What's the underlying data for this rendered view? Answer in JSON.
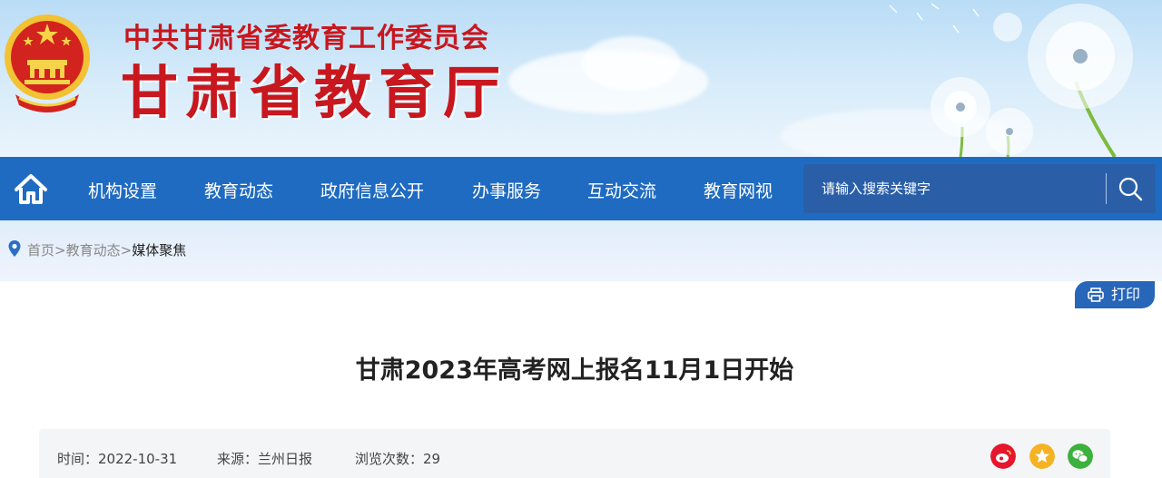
{
  "header": {
    "org_line": "中共甘肃省委教育工作委员会",
    "site_name": "甘肃省教育厅"
  },
  "nav": {
    "home_icon": "home-icon",
    "items": [
      "机构设置",
      "教育动态",
      "政府信息公开",
      "办事服务",
      "互动交流",
      "教育网视"
    ],
    "search_placeholder": "请输入搜索关键字",
    "search_icon": "search-icon"
  },
  "breadcrumb": {
    "icon": "location-pin-icon",
    "home": "首页",
    "sep": ">",
    "section": "教育动态",
    "current": "媒体聚焦"
  },
  "article": {
    "print_label": "打印",
    "print_icon": "printer-icon",
    "title": "甘肃2023年高考网上报名11月1日开始",
    "time_label": "时间：2022-10-31",
    "source_label": "来源：兰州日报",
    "views_label": "浏览次数：29",
    "share_icons": [
      "weibo-icon",
      "favorite-star-icon",
      "wechat-icon"
    ]
  },
  "colors": {
    "brand_red": "#c8171e",
    "nav_blue": "#1f6bc2",
    "search_bg": "#2a5fa8",
    "weibo": "#e6162d",
    "star": "#f5b323",
    "wechat": "#3db13d"
  }
}
